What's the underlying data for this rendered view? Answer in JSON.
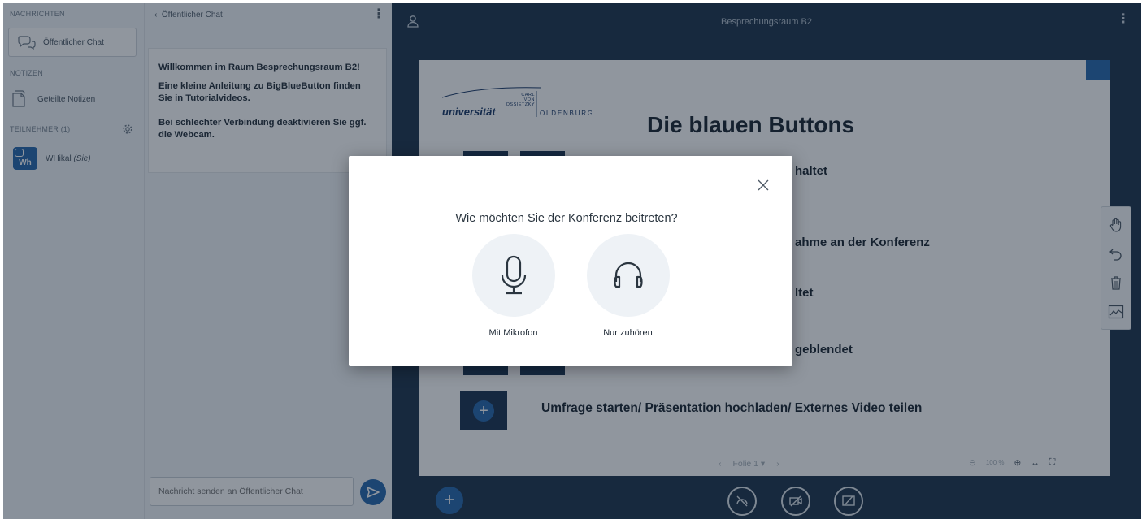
{
  "sidebar": {
    "messages_heading": "NACHRICHTEN",
    "public_chat_label": "Öffentlicher Chat",
    "notes_heading": "NOTIZEN",
    "shared_notes_label": "Geteilte Notizen",
    "participants_heading": "TEILNEHMER (1)",
    "user": {
      "avatar_initials": "Wh",
      "name": "WHikal",
      "you_tag": "(Sie)"
    }
  },
  "chat": {
    "header_title": "Öffentlicher Chat",
    "welcome_title": "Willkommen im Raum Besprechungsraum B2!",
    "tutorial_text": "Eine kleine Anleitung zu BigBlueButton finden Sie in",
    "tutorial_link": "Tutorialvideos",
    "tutorial_end": ".",
    "connection_tip": "Bei schlechter Verbindung deaktivieren Sie ggf. die Webcam.",
    "input_placeholder": "Nachricht senden an Öffentlicher Chat"
  },
  "main": {
    "room_title": "Besprechungsraum B2",
    "slide": {
      "logo_small": "CARL VON OSSIETZKY",
      "logo_uni": "universität",
      "logo_city": "OLDENBURG",
      "title": "Die blauen Buttons",
      "line1": "haltet",
      "line2": "ahme an der Konferenz",
      "line3": "ltet",
      "line4": "geblendet",
      "line5": "Umfrage starten/ Präsentation hochladen/ Externes Video teilen"
    },
    "footer": {
      "slide_selector": "Folie 1",
      "zoom": "100 %"
    }
  },
  "modal": {
    "question": "Wie möchten Sie der Konferenz beitreten?",
    "microphone_label": "Mit Mikrofon",
    "listen_only_label": "Nur zuhören"
  },
  "colors": {
    "accent": "#2d6cb0",
    "background": "#243a51",
    "panel": "#f3f6f9"
  }
}
